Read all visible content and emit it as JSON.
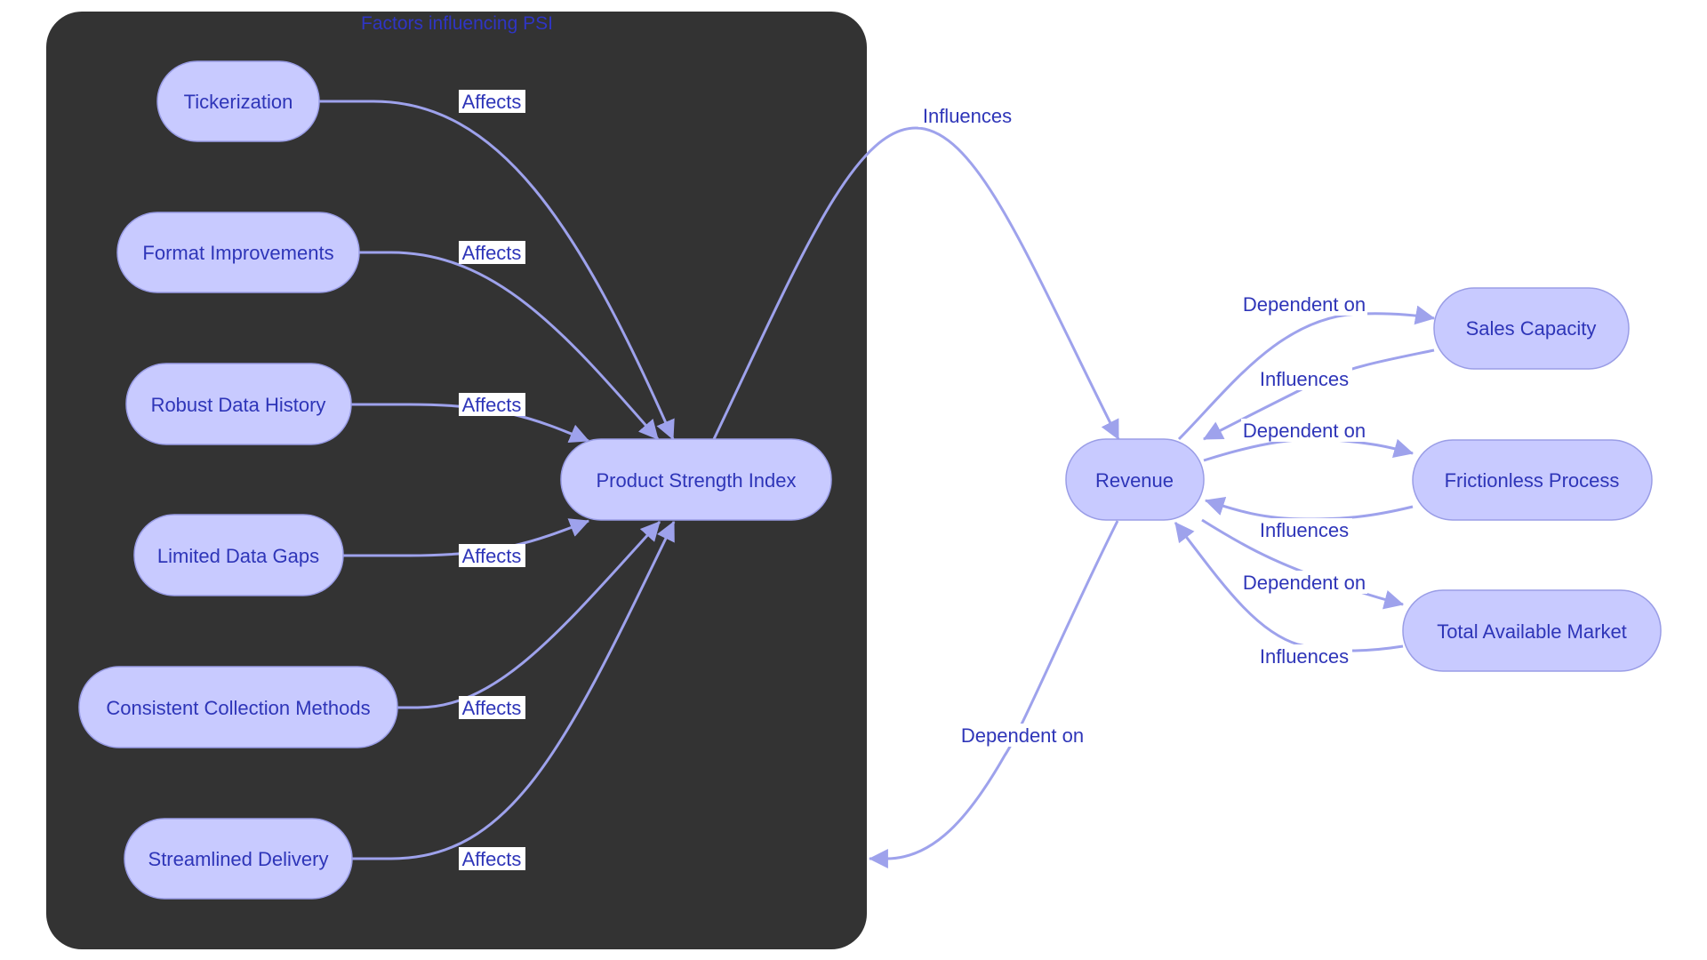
{
  "cluster": {
    "title": "Factors influencing PSI",
    "background_color": "#333333"
  },
  "colors": {
    "node_fill": "#c8caff",
    "node_stroke": "#9a9de6",
    "node_text": "#2e35b8",
    "edge": "#9ea2ec",
    "label_bg": "#ffffff"
  },
  "nodes": {
    "tickerization": "Tickerization",
    "format": "Format Improvements",
    "robust": "Robust Data History",
    "limited": "Limited Data Gaps",
    "consistent": "Consistent Collection Methods",
    "streamlined": "Streamlined Delivery",
    "psi": "Product Strength Index",
    "revenue": "Revenue",
    "sales": "Sales Capacity",
    "frictionless": "Frictionless Process",
    "tam": "Total Available Market"
  },
  "edges": [
    {
      "id": "e1",
      "from": "Tickerization",
      "to": "Product Strength Index",
      "label": "Affects"
    },
    {
      "id": "e2",
      "from": "Format Improvements",
      "to": "Product Strength Index",
      "label": "Affects"
    },
    {
      "id": "e3",
      "from": "Robust Data History",
      "to": "Product Strength Index",
      "label": "Affects"
    },
    {
      "id": "e4",
      "from": "Limited Data Gaps",
      "to": "Product Strength Index",
      "label": "Affects"
    },
    {
      "id": "e5",
      "from": "Consistent Collection Methods",
      "to": "Product Strength Index",
      "label": "Affects"
    },
    {
      "id": "e6",
      "from": "Streamlined Delivery",
      "to": "Product Strength Index",
      "label": "Affects"
    },
    {
      "id": "e7",
      "from": "Product Strength Index",
      "to": "Revenue",
      "label": "Influences"
    },
    {
      "id": "e8",
      "from": "Revenue",
      "to": "Factors influencing PSI",
      "label": "Dependent on"
    },
    {
      "id": "e9",
      "from": "Revenue",
      "to": "Sales Capacity",
      "label": "Dependent on"
    },
    {
      "id": "e10",
      "from": "Sales Capacity",
      "to": "Revenue",
      "label": "Influences"
    },
    {
      "id": "e11",
      "from": "Revenue",
      "to": "Frictionless Process",
      "label": "Dependent on"
    },
    {
      "id": "e12",
      "from": "Frictionless Process",
      "to": "Revenue",
      "label": "Influences"
    },
    {
      "id": "e13",
      "from": "Revenue",
      "to": "Total Available Market",
      "label": "Dependent on"
    },
    {
      "id": "e14",
      "from": "Total Available Market",
      "to": "Revenue",
      "label": "Influences"
    }
  ]
}
